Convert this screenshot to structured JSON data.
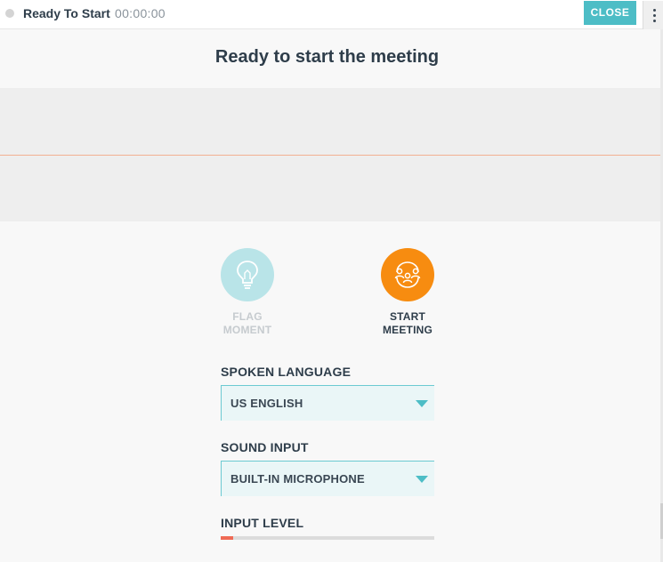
{
  "topbar": {
    "status_label": "Ready To Start",
    "timer": "00:00:00",
    "close_label": "CLOSE"
  },
  "main": {
    "title": "Ready to start the meeting",
    "actions": [
      {
        "line1": "FLAG",
        "line2": "MOMENT",
        "icon": "lightbulb-icon",
        "enabled": false
      },
      {
        "line1": "START",
        "line2": "MEETING",
        "icon": "meeting-people-icon",
        "enabled": true
      }
    ]
  },
  "settings": {
    "spoken_language": {
      "label": "SPOKEN LANGUAGE",
      "value": "US ENGLISH"
    },
    "sound_input": {
      "label": "SOUND INPUT",
      "value": "BUILT-IN MICROPHONE"
    },
    "input_level": {
      "label": "INPUT LEVEL",
      "level_fraction": 0.06
    }
  },
  "colors": {
    "accent": "#4dbdc6",
    "start": "#f78c10",
    "flag_disabled": "#b9e4e8",
    "level": "#ef6a55",
    "waveform_line": "#f2b092"
  }
}
